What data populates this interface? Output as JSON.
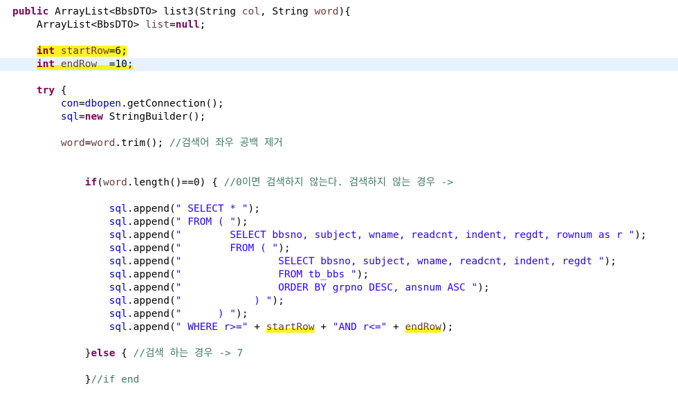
{
  "editor": {
    "current_line_color": "#e8f2fe",
    "highlight_color": "#fff000",
    "lines": [
      {
        "t": "public ArrayList<BbsDTO> list3(String col, String word){"
      },
      {
        "t": "    ArrayList<BbsDTO> list=null;"
      },
      {
        "t": ""
      },
      {
        "t": "    int startRow=6;"
      },
      {
        "t": "    int endRow  =10;"
      },
      {
        "t": ""
      },
      {
        "t": "    try {"
      },
      {
        "t": "        con=dbopen.getConnection();"
      },
      {
        "t": "        sql=new StringBuilder();"
      },
      {
        "t": ""
      },
      {
        "t": "        word=word.trim(); //검색어 좌우 공백 제거"
      },
      {
        "t": ""
      },
      {
        "t": ""
      },
      {
        "t": "            if(word.length()==0) { //0이면 검색하지 않는다. 검색하지 않는 경우 ->"
      },
      {
        "t": ""
      },
      {
        "t": "                sql.append(\" SELECT * \");"
      },
      {
        "t": "                sql.append(\" FROM ( \");"
      },
      {
        "t": "                sql.append(\"        SELECT bbsno, subject, wname, readcnt, indent, regdt, rownum as r \");"
      },
      {
        "t": "                sql.append(\"        FROM ( \");"
      },
      {
        "t": "                sql.append(\"                SELECT bbsno, subject, wname, readcnt, indent, regdt \");"
      },
      {
        "t": "                sql.append(\"                FROM tb_bbs \");"
      },
      {
        "t": "                sql.append(\"                ORDER BY grpno DESC, ansnum ASC \");"
      },
      {
        "t": "                sql.append(\"            ) \");"
      },
      {
        "t": "                sql.append(\"      ) \");"
      },
      {
        "t": "                sql.append(\" WHERE r>=\" + startRow + \"AND r<=\" + endRow);"
      },
      {
        "t": ""
      },
      {
        "t": "            }else { //검색 하는 경우 -> 7"
      },
      {
        "t": ""
      },
      {
        "t": "            }//if end"
      }
    ]
  }
}
